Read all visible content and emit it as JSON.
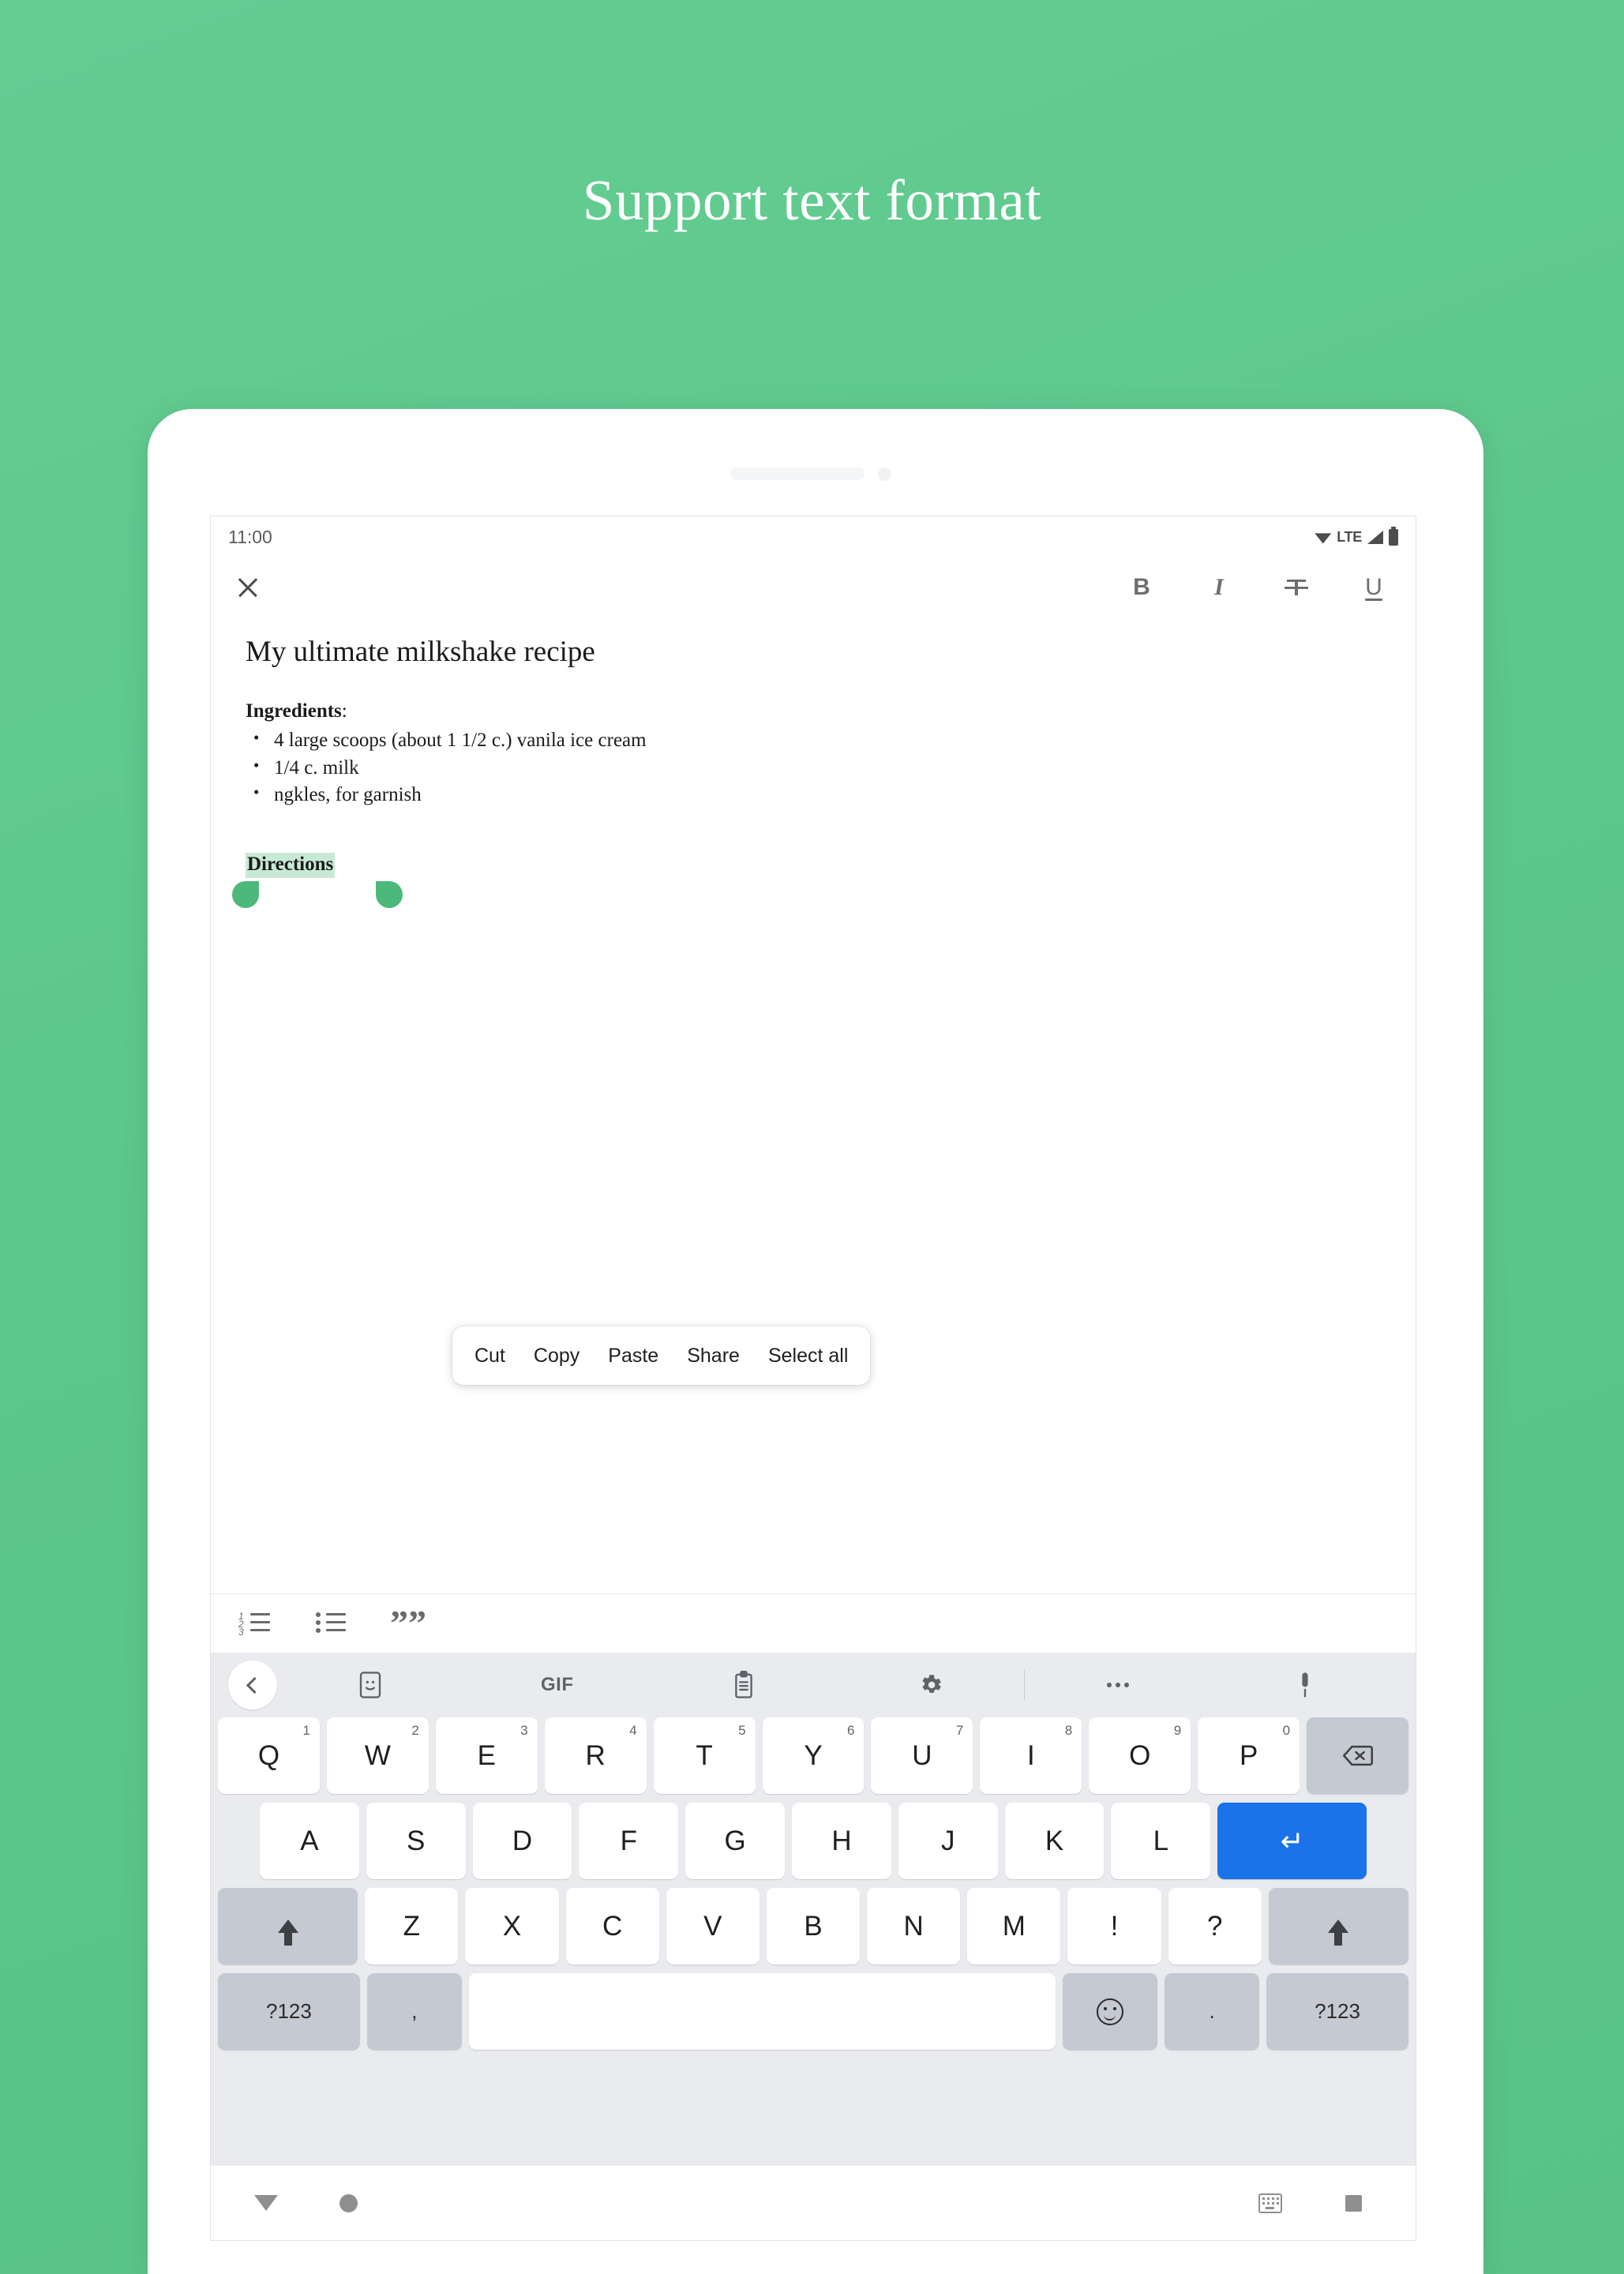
{
  "headline": "Support text format",
  "theme": {
    "background_green": "#5cc78b",
    "selection_highlight": "#c8ead5",
    "selection_handle": "#4cb87a",
    "enter_key_blue": "#1a73e8"
  },
  "status_bar": {
    "time": "11:00",
    "network_label": "LTE",
    "icons": [
      "wifi-icon",
      "signal-icon",
      "battery-icon"
    ]
  },
  "edit_toolbar": {
    "close_label": "×",
    "bold_label": "B",
    "italic_label": "I",
    "strikethrough_label": "S",
    "underline_label": "U"
  },
  "note": {
    "title": "My ultimate milkshake recipe",
    "ingredients_heading": "Ingredients",
    "ingredients_colon": ":",
    "ingredients": [
      "4 large scoops (about 1 1/2 c.) vanila ice cream",
      "1/4 c. milk",
      "ngkles, for garnish"
    ],
    "directions_heading": "Directions"
  },
  "context_menu": {
    "items": [
      {
        "label": "Cut"
      },
      {
        "label": "Copy"
      },
      {
        "label": "Paste"
      },
      {
        "label": "Share"
      },
      {
        "label": "Select all"
      }
    ]
  },
  "format_toolbar": {
    "items": [
      {
        "name": "numbered-list",
        "marks": [
          "1",
          "2",
          "3"
        ]
      },
      {
        "name": "bulleted-list"
      },
      {
        "name": "blockquote",
        "glyph": "””"
      }
    ]
  },
  "keyboard": {
    "toolbar": [
      {
        "name": "back-chevron"
      },
      {
        "name": "sticker"
      },
      {
        "name": "gif",
        "label": "GIF"
      },
      {
        "name": "clipboard"
      },
      {
        "name": "settings-gear"
      },
      {
        "name": "more-options"
      },
      {
        "name": "microphone"
      }
    ],
    "row1": [
      {
        "key": "Q",
        "num": "1"
      },
      {
        "key": "W",
        "num": "2"
      },
      {
        "key": "E",
        "num": "3"
      },
      {
        "key": "R",
        "num": "4"
      },
      {
        "key": "T",
        "num": "5"
      },
      {
        "key": "Y",
        "num": "6"
      },
      {
        "key": "U",
        "num": "7"
      },
      {
        "key": "I",
        "num": "8"
      },
      {
        "key": "O",
        "num": "9"
      },
      {
        "key": "P",
        "num": "0"
      }
    ],
    "row1_action": "backspace",
    "row2": [
      "A",
      "S",
      "D",
      "F",
      "G",
      "H",
      "J",
      "K",
      "L"
    ],
    "row2_action": "enter",
    "row3": [
      "Z",
      "X",
      "C",
      "V",
      "B",
      "N",
      "M",
      "!",
      "?"
    ],
    "row3_shift_left": "shift",
    "row3_shift_right": "shift",
    "row4": {
      "symbols_left": "?123",
      "comma": ",",
      "space": "",
      "emoji": "emoji",
      "period": ".",
      "symbols_right": "?123"
    }
  },
  "nav_bar": {
    "items": [
      "hide-keyboard",
      "home",
      "keyboard-switch",
      "recents"
    ]
  }
}
